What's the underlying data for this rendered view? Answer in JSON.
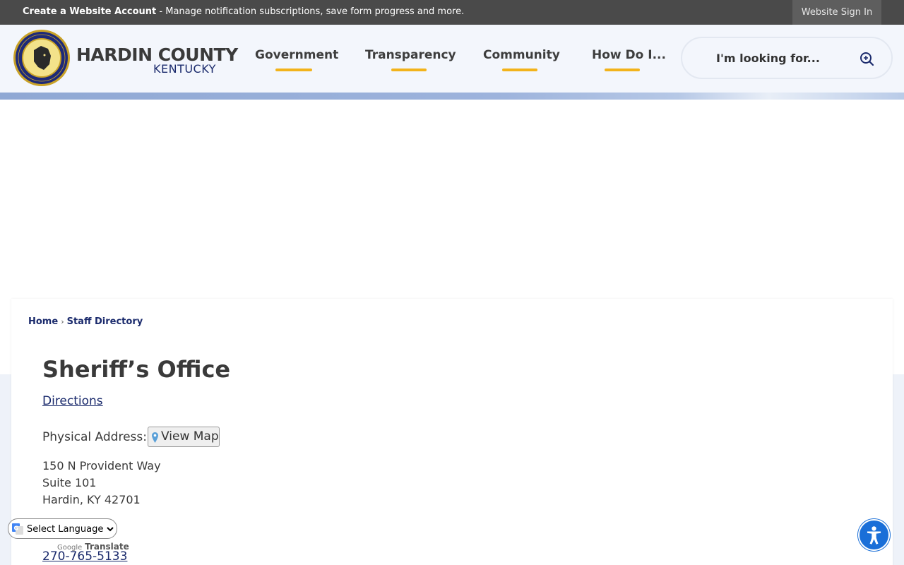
{
  "topbar": {
    "create_account_bold": "Create a Website Account",
    "create_account_rest": " - Manage notification subscriptions, save form progress and more.",
    "sign_in": "Website Sign In"
  },
  "header": {
    "brand_line_1": "HARDIN COUNTY",
    "brand_line_2": "KENTUCKY",
    "logo_icon": "county-seal",
    "nav": [
      {
        "label": "Government"
      },
      {
        "label": "Transparency"
      },
      {
        "label": "Community"
      },
      {
        "label": "How Do I..."
      }
    ],
    "search": {
      "placeholder": "I'm looking for...",
      "icon": "search-plus-icon"
    },
    "accent_color": "#f2b31b"
  },
  "breadcrumb": {
    "home": "Home",
    "separator": "›",
    "current": "Staff Directory"
  },
  "main": {
    "title": "Sheriff’s Office",
    "directions": "Directions",
    "physical_address_label": "Physical Address:",
    "view_map": "View Map",
    "address_lines": [
      "150 N Provident Way",
      "Suite 101",
      "Hardin, KY 42701"
    ],
    "phone": "270-765-5133"
  },
  "translate": {
    "select_label": "Select Language",
    "powered_google": "Google",
    "powered_translate": "Translate"
  },
  "colors": {
    "link": "#1a2a6c",
    "topbar": "#4a4a4a",
    "accessibility": "#1a6fd8"
  }
}
